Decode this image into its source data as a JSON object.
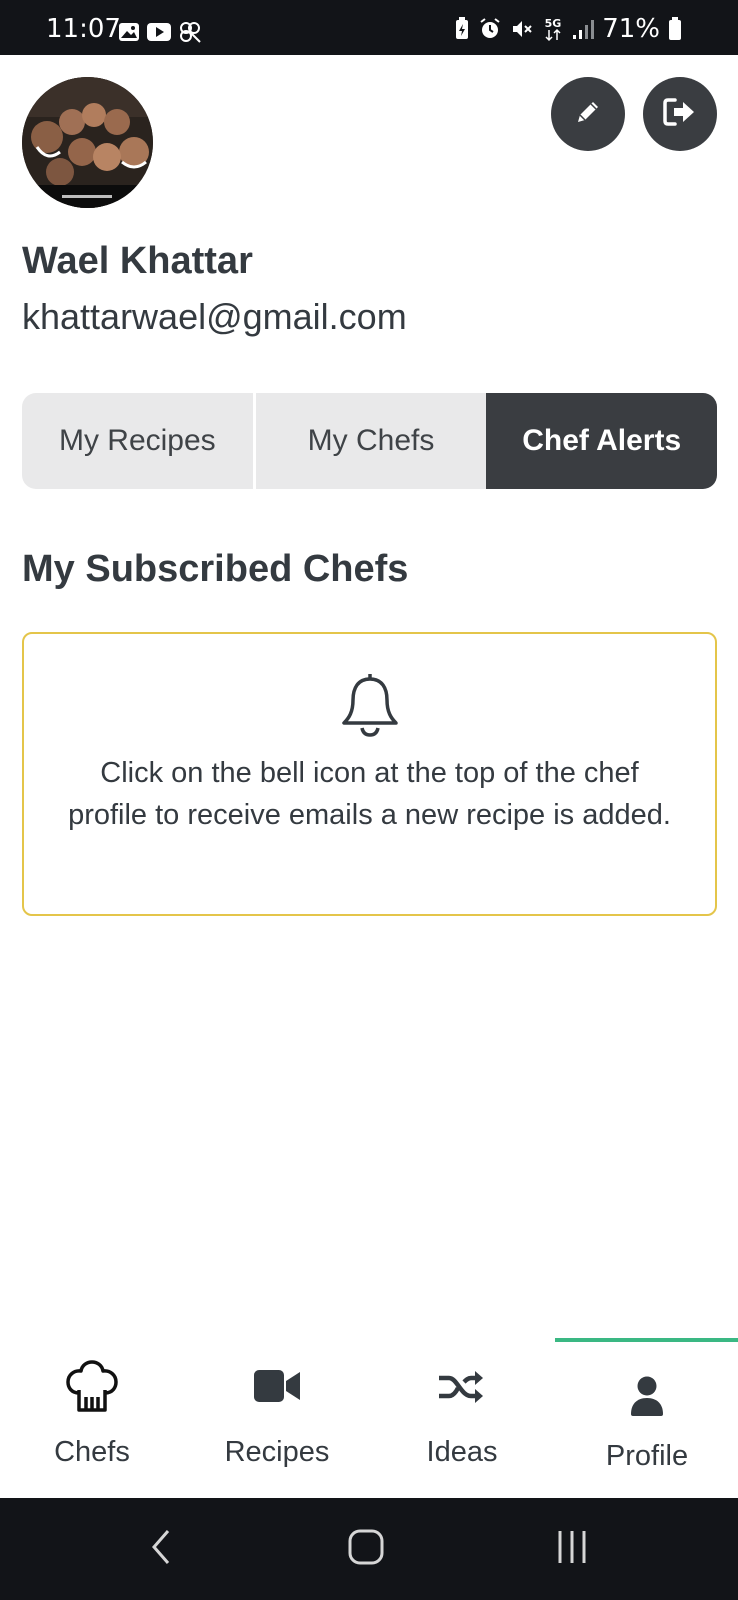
{
  "status_bar": {
    "time": "11:07",
    "battery_percent": "71%",
    "network": "5G",
    "left_icons": [
      "gallery-icon",
      "youtube-icon",
      "pinwheel-icon"
    ],
    "right_icons": [
      "battery-saver-icon",
      "alarm-icon",
      "mute-icon",
      "5g-icon",
      "signal-icon",
      "battery-icon"
    ]
  },
  "profile": {
    "name": "Wael Khattar",
    "email": "khattarwael@gmail.com",
    "avatar_icon": "user-photo",
    "edit_icon": "pencil-icon",
    "logout_icon": "logout-icon"
  },
  "tabs": [
    {
      "label": "My Recipes",
      "active": false
    },
    {
      "label": "My Chefs",
      "active": false
    },
    {
      "label": "Chef Alerts",
      "active": true
    }
  ],
  "section": {
    "title": "My Subscribed Chefs",
    "alert_icon": "bell-icon",
    "alert_text": "Click on the bell icon at the top of the chef profile to receive emails a new recipe is added."
  },
  "bottom_nav": [
    {
      "label": "Chefs",
      "icon": "chef-hat-icon",
      "active": false
    },
    {
      "label": "Recipes",
      "icon": "video-camera-icon",
      "active": false
    },
    {
      "label": "Ideas",
      "icon": "shuffle-icon",
      "active": false
    },
    {
      "label": "Profile",
      "icon": "user-icon",
      "active": true
    }
  ],
  "colors": {
    "dark": "#3a3d41",
    "tab_inactive": "#e9e9ea",
    "alert_border": "#e4c54a",
    "nav_indicator": "#3ab883",
    "system_bar": "#121418"
  }
}
